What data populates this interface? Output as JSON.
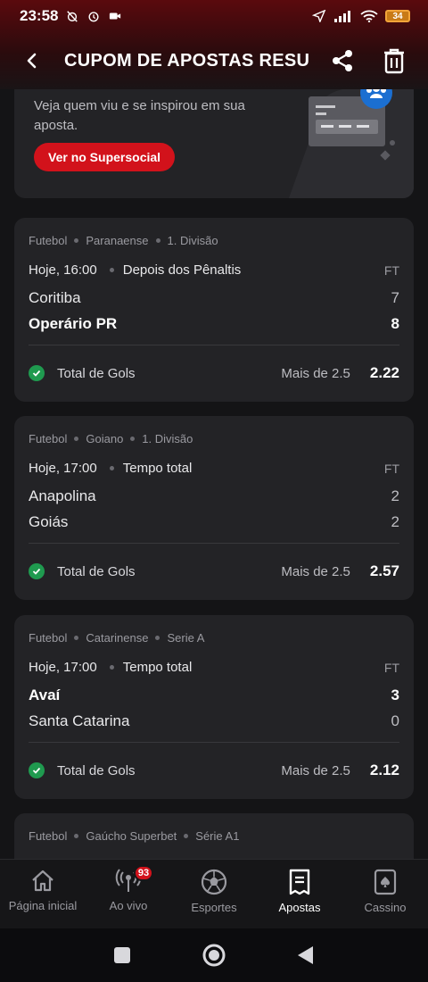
{
  "status": {
    "time": "23:58",
    "battery": "34"
  },
  "header": {
    "title": "CUPOM DE APOSTAS RESULT..."
  },
  "promo": {
    "text": "Veja quem viu e se inspirou em sua aposta.",
    "button": "Ver no Supersocial"
  },
  "events": [
    {
      "sport": "Futebol",
      "league": "Paranaense",
      "division": "1. Divisão",
      "time": "Hoje, 16:00",
      "state": "Depois dos Pênaltis",
      "result": "FT",
      "home": "Coritiba",
      "home_score": "7",
      "away": "Operário PR",
      "away_score": "8",
      "market": "Total de Gols",
      "selection": "Mais de 2.5",
      "odd": "2.22"
    },
    {
      "sport": "Futebol",
      "league": "Goiano",
      "division": "1. Divisão",
      "time": "Hoje, 17:00",
      "state": "Tempo total",
      "result": "FT",
      "home": "Anapolina",
      "home_score": "2",
      "away": "Goiás",
      "away_score": "2",
      "market": "Total de Gols",
      "selection": "Mais de 2.5",
      "odd": "2.57"
    },
    {
      "sport": "Futebol",
      "league": "Catarinense",
      "division": "Serie A",
      "time": "Hoje, 17:00",
      "state": "Tempo total",
      "result": "FT",
      "home": "Avaí",
      "home_score": "3",
      "away": "Santa Catarina",
      "away_score": "0",
      "market": "Total de Gols",
      "selection": "Mais de 2.5",
      "odd": "2.12"
    },
    {
      "sport": "Futebol",
      "league": "Gaúcho Superbet",
      "division": "Série A1"
    }
  ],
  "nav": [
    {
      "label": "Página inicial",
      "icon": "home-icon"
    },
    {
      "label": "Ao vivo",
      "icon": "live-icon",
      "badge": "93"
    },
    {
      "label": "Esportes",
      "icon": "soccer-ball-icon"
    },
    {
      "label": "Apostas",
      "icon": "receipt-icon",
      "active": true
    },
    {
      "label": "Cassino",
      "icon": "card-icon"
    }
  ],
  "colors": {
    "accent": "#d2121b",
    "success": "#1f9a4f",
    "card": "#232326",
    "bg": "#141416"
  }
}
